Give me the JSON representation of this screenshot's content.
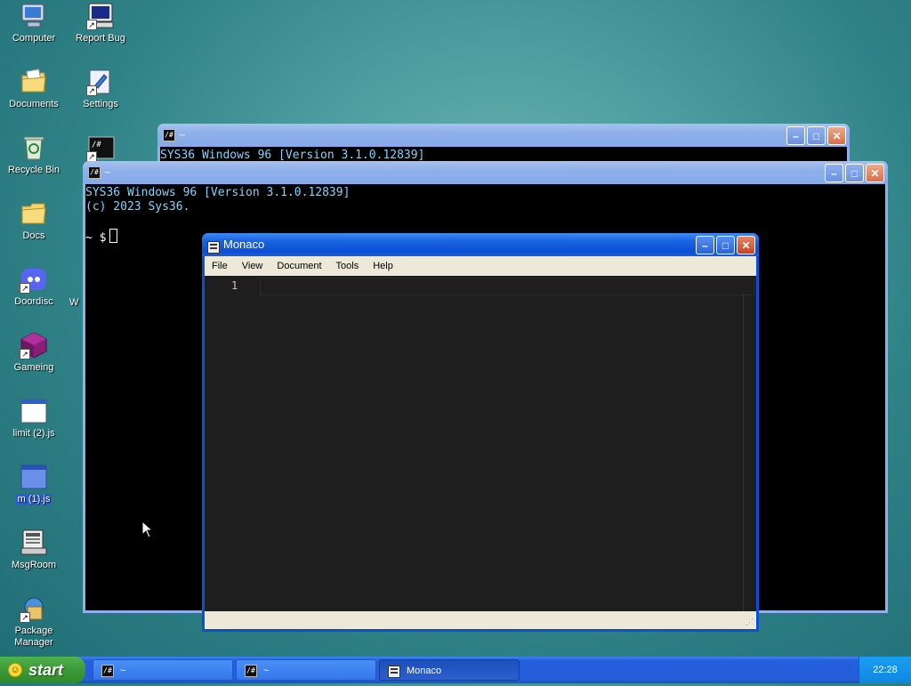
{
  "desktop": {
    "icons": [
      {
        "label": "Computer"
      },
      {
        "label": "Report Bug"
      },
      {
        "label": "Documents"
      },
      {
        "label": "Settings"
      },
      {
        "label": "Recycle Bin"
      },
      {
        "label": "Docs"
      },
      {
        "label": "Doordisc"
      },
      {
        "label": "Gameing"
      },
      {
        "label": "limit (2).js"
      },
      {
        "label": "m (1).js"
      },
      {
        "label": "MsgRoom"
      },
      {
        "label": "Package Manager"
      }
    ],
    "partial_label": "W"
  },
  "terminal_back": {
    "title": "~",
    "lines": [
      "SYS36 Windows 96 [Version 3.1.0.12839]"
    ]
  },
  "terminal_front": {
    "title": "~",
    "lines": [
      "SYS36 Windows 96 [Version 3.1.0.12839]",
      "(c) 2023 Sys36.",
      ""
    ],
    "prompt": "~ $"
  },
  "monaco": {
    "title": "Monaco",
    "menu": [
      "File",
      "View",
      "Document",
      "Tools",
      "Help"
    ],
    "line_number": "1"
  },
  "taskbar": {
    "start_label": "start",
    "tasks": [
      {
        "label": "~"
      },
      {
        "label": "~"
      },
      {
        "label": "Monaco"
      }
    ],
    "clock": "22:28"
  },
  "colors": {
    "terminal_text": "#7fd4ff",
    "editor_bg": "#1e1e1e",
    "taskbar": "#245edb",
    "start_green": "#3c9a37"
  }
}
